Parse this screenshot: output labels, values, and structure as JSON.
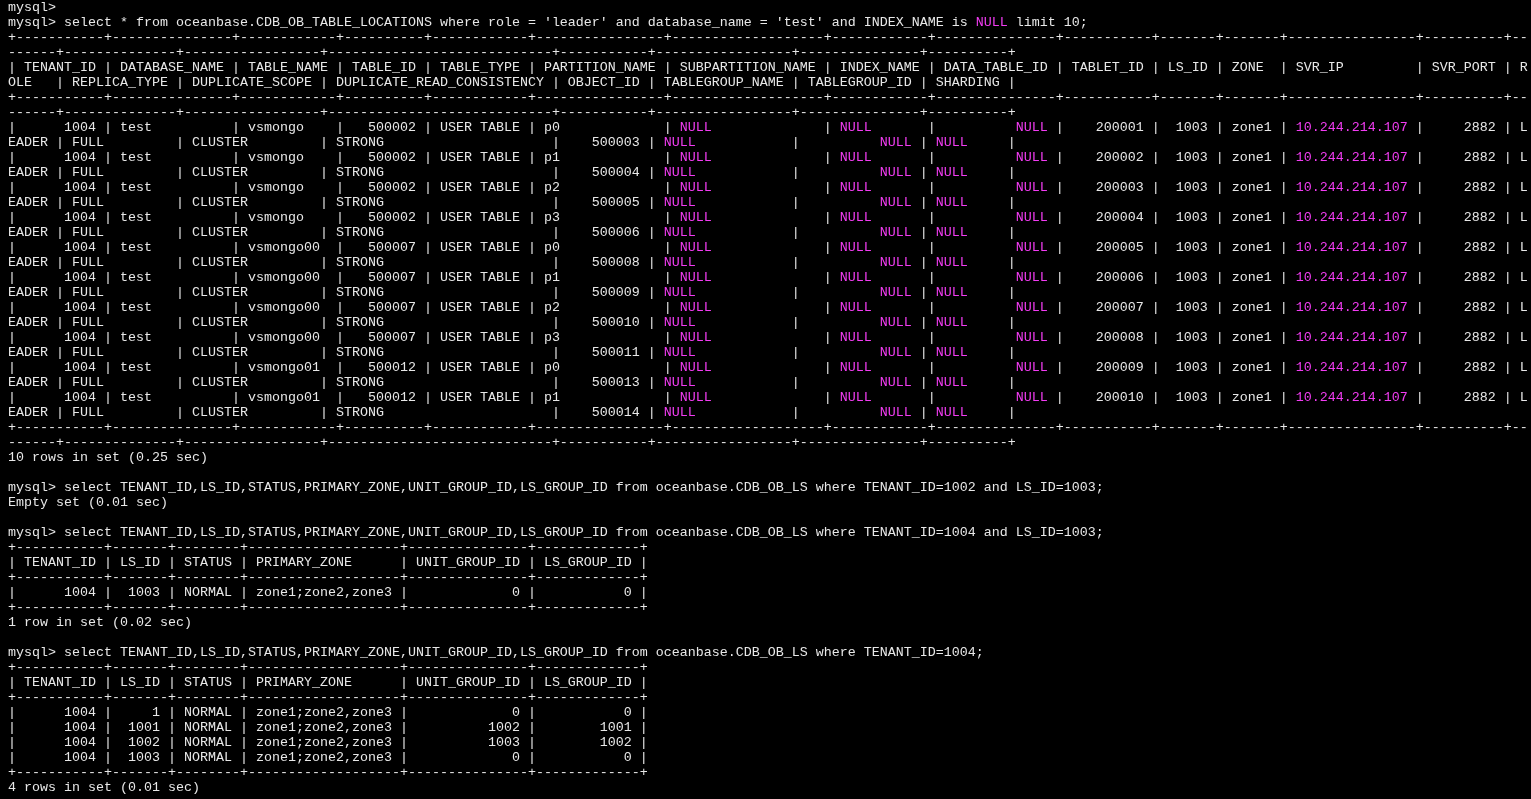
{
  "terminal": {
    "lines": [
      {
        "kind": "text",
        "parts": [
          {
            "text": "mysql>",
            "highlight": false
          }
        ]
      },
      {
        "kind": "text",
        "parts": [
          {
            "text": "mysql> select * from oceanbase.CDB_OB_TABLE_LOCATIONS where role = 'leader' and database_name = 'test' and INDEX_NAME is ",
            "highlight": false
          },
          {
            "text": "NULL",
            "highlight": true
          },
          {
            "text": " limit 10;",
            "highlight": false
          }
        ]
      },
      {
        "kind": "text",
        "parts": [
          {
            "text": "+-----------+---------------+------------+----------+------------+----------------+-------------------+------------+---------------+-----------+-------+-------+----------------+----------+--",
            "highlight": false
          }
        ]
      },
      {
        "kind": "text",
        "parts": [
          {
            "text": "------+--------------+-----------------+----------------------------+-----------+-----------------+---------------+----------+",
            "highlight": false
          }
        ]
      },
      {
        "kind": "text",
        "parts": [
          {
            "text": "| TENANT_ID | DATABASE_NAME | TABLE_NAME | TABLE_ID | TABLE_TYPE | PARTITION_NAME | SUBPARTITION_NAME | INDEX_NAME | DATA_TABLE_ID | TABLET_ID | LS_ID | ZONE  | SVR_IP         | SVR_PORT | R",
            "highlight": false
          }
        ]
      },
      {
        "kind": "text",
        "parts": [
          {
            "text": "OLE   | REPLICA_TYPE | DUPLICATE_SCOPE | DUPLICATE_READ_CONSISTENCY | OBJECT_ID | TABLEGROUP_NAME | TABLEGROUP_ID | SHARDING |",
            "highlight": false
          }
        ]
      },
      {
        "kind": "text",
        "parts": [
          {
            "text": "+-----------+---------------+------------+----------+------------+----------------+-------------------+------------+---------------+-----------+-------+-------+----------------+----------+--",
            "highlight": false
          }
        ]
      },
      {
        "kind": "text",
        "parts": [
          {
            "text": "------+--------------+-----------------+----------------------------+-----------+-----------------+---------------+----------+",
            "highlight": false
          }
        ]
      },
      {
        "kind": "text",
        "parts": [
          {
            "text": "|      1004 | test          | vsmongo    |   500002 | USER TABLE | p0             | ",
            "highlight": false
          },
          {
            "text": "NULL",
            "highlight": true
          },
          {
            "text": "              | ",
            "highlight": false
          },
          {
            "text": "NULL",
            "highlight": true
          },
          {
            "text": "       |          ",
            "highlight": false
          },
          {
            "text": "NULL",
            "highlight": true
          },
          {
            "text": " |    200001 |  1003 | zone1 | ",
            "highlight": false
          },
          {
            "text": "10.244.214.107",
            "highlight": true
          },
          {
            "text": " |     2882 | L",
            "highlight": false
          }
        ]
      },
      {
        "kind": "text",
        "parts": [
          {
            "text": "EADER | FULL         | CLUSTER         | STRONG                     |    500003 | ",
            "highlight": false
          },
          {
            "text": "NULL",
            "highlight": true
          },
          {
            "text": "            |          ",
            "highlight": false
          },
          {
            "text": "NULL",
            "highlight": true
          },
          {
            "text": " | ",
            "highlight": false
          },
          {
            "text": "NULL",
            "highlight": true
          },
          {
            "text": "     |",
            "highlight": false
          }
        ]
      },
      {
        "kind": "text",
        "parts": [
          {
            "text": "|      1004 | test          | vsmongo    |   500002 | USER TABLE | p1             | ",
            "highlight": false
          },
          {
            "text": "NULL",
            "highlight": true
          },
          {
            "text": "              | ",
            "highlight": false
          },
          {
            "text": "NULL",
            "highlight": true
          },
          {
            "text": "       |          ",
            "highlight": false
          },
          {
            "text": "NULL",
            "highlight": true
          },
          {
            "text": " |    200002 |  1003 | zone1 | ",
            "highlight": false
          },
          {
            "text": "10.244.214.107",
            "highlight": true
          },
          {
            "text": " |     2882 | L",
            "highlight": false
          }
        ]
      },
      {
        "kind": "text",
        "parts": [
          {
            "text": "EADER | FULL         | CLUSTER         | STRONG                     |    500004 | ",
            "highlight": false
          },
          {
            "text": "NULL",
            "highlight": true
          },
          {
            "text": "            |          ",
            "highlight": false
          },
          {
            "text": "NULL",
            "highlight": true
          },
          {
            "text": " | ",
            "highlight": false
          },
          {
            "text": "NULL",
            "highlight": true
          },
          {
            "text": "     |",
            "highlight": false
          }
        ]
      },
      {
        "kind": "text",
        "parts": [
          {
            "text": "|      1004 | test          | vsmongo    |   500002 | USER TABLE | p2             | ",
            "highlight": false
          },
          {
            "text": "NULL",
            "highlight": true
          },
          {
            "text": "              | ",
            "highlight": false
          },
          {
            "text": "NULL",
            "highlight": true
          },
          {
            "text": "       |          ",
            "highlight": false
          },
          {
            "text": "NULL",
            "highlight": true
          },
          {
            "text": " |    200003 |  1003 | zone1 | ",
            "highlight": false
          },
          {
            "text": "10.244.214.107",
            "highlight": true
          },
          {
            "text": " |     2882 | L",
            "highlight": false
          }
        ]
      },
      {
        "kind": "text",
        "parts": [
          {
            "text": "EADER | FULL         | CLUSTER         | STRONG                     |    500005 | ",
            "highlight": false
          },
          {
            "text": "NULL",
            "highlight": true
          },
          {
            "text": "            |          ",
            "highlight": false
          },
          {
            "text": "NULL",
            "highlight": true
          },
          {
            "text": " | ",
            "highlight": false
          },
          {
            "text": "NULL",
            "highlight": true
          },
          {
            "text": "     |",
            "highlight": false
          }
        ]
      },
      {
        "kind": "text",
        "parts": [
          {
            "text": "|      1004 | test          | vsmongo    |   500002 | USER TABLE | p3             | ",
            "highlight": false
          },
          {
            "text": "NULL",
            "highlight": true
          },
          {
            "text": "              | ",
            "highlight": false
          },
          {
            "text": "NULL",
            "highlight": true
          },
          {
            "text": "       |          ",
            "highlight": false
          },
          {
            "text": "NULL",
            "highlight": true
          },
          {
            "text": " |    200004 |  1003 | zone1 | ",
            "highlight": false
          },
          {
            "text": "10.244.214.107",
            "highlight": true
          },
          {
            "text": " |     2882 | L",
            "highlight": false
          }
        ]
      },
      {
        "kind": "text",
        "parts": [
          {
            "text": "EADER | FULL         | CLUSTER         | STRONG                     |    500006 | ",
            "highlight": false
          },
          {
            "text": "NULL",
            "highlight": true
          },
          {
            "text": "            |          ",
            "highlight": false
          },
          {
            "text": "NULL",
            "highlight": true
          },
          {
            "text": " | ",
            "highlight": false
          },
          {
            "text": "NULL",
            "highlight": true
          },
          {
            "text": "     |",
            "highlight": false
          }
        ]
      },
      {
        "kind": "text",
        "parts": [
          {
            "text": "|      1004 | test          | vsmongo00  |   500007 | USER TABLE | p0             | ",
            "highlight": false
          },
          {
            "text": "NULL",
            "highlight": true
          },
          {
            "text": "              | ",
            "highlight": false
          },
          {
            "text": "NULL",
            "highlight": true
          },
          {
            "text": "       |          ",
            "highlight": false
          },
          {
            "text": "NULL",
            "highlight": true
          },
          {
            "text": " |    200005 |  1003 | zone1 | ",
            "highlight": false
          },
          {
            "text": "10.244.214.107",
            "highlight": true
          },
          {
            "text": " |     2882 | L",
            "highlight": false
          }
        ]
      },
      {
        "kind": "text",
        "parts": [
          {
            "text": "EADER | FULL         | CLUSTER         | STRONG                     |    500008 | ",
            "highlight": false
          },
          {
            "text": "NULL",
            "highlight": true
          },
          {
            "text": "            |          ",
            "highlight": false
          },
          {
            "text": "NULL",
            "highlight": true
          },
          {
            "text": " | ",
            "highlight": false
          },
          {
            "text": "NULL",
            "highlight": true
          },
          {
            "text": "     |",
            "highlight": false
          }
        ]
      },
      {
        "kind": "text",
        "parts": [
          {
            "text": "|      1004 | test          | vsmongo00  |   500007 | USER TABLE | p1             | ",
            "highlight": false
          },
          {
            "text": "NULL",
            "highlight": true
          },
          {
            "text": "              | ",
            "highlight": false
          },
          {
            "text": "NULL",
            "highlight": true
          },
          {
            "text": "       |          ",
            "highlight": false
          },
          {
            "text": "NULL",
            "highlight": true
          },
          {
            "text": " |    200006 |  1003 | zone1 | ",
            "highlight": false
          },
          {
            "text": "10.244.214.107",
            "highlight": true
          },
          {
            "text": " |     2882 | L",
            "highlight": false
          }
        ]
      },
      {
        "kind": "text",
        "parts": [
          {
            "text": "EADER | FULL         | CLUSTER         | STRONG                     |    500009 | ",
            "highlight": false
          },
          {
            "text": "NULL",
            "highlight": true
          },
          {
            "text": "            |          ",
            "highlight": false
          },
          {
            "text": "NULL",
            "highlight": true
          },
          {
            "text": " | ",
            "highlight": false
          },
          {
            "text": "NULL",
            "highlight": true
          },
          {
            "text": "     |",
            "highlight": false
          }
        ]
      },
      {
        "kind": "text",
        "parts": [
          {
            "text": "|      1004 | test          | vsmongo00  |   500007 | USER TABLE | p2             | ",
            "highlight": false
          },
          {
            "text": "NULL",
            "highlight": true
          },
          {
            "text": "              | ",
            "highlight": false
          },
          {
            "text": "NULL",
            "highlight": true
          },
          {
            "text": "       |          ",
            "highlight": false
          },
          {
            "text": "NULL",
            "highlight": true
          },
          {
            "text": " |    200007 |  1003 | zone1 | ",
            "highlight": false
          },
          {
            "text": "10.244.214.107",
            "highlight": true
          },
          {
            "text": " |     2882 | L",
            "highlight": false
          }
        ]
      },
      {
        "kind": "text",
        "parts": [
          {
            "text": "EADER | FULL         | CLUSTER         | STRONG                     |    500010 | ",
            "highlight": false
          },
          {
            "text": "NULL",
            "highlight": true
          },
          {
            "text": "            |          ",
            "highlight": false
          },
          {
            "text": "NULL",
            "highlight": true
          },
          {
            "text": " | ",
            "highlight": false
          },
          {
            "text": "NULL",
            "highlight": true
          },
          {
            "text": "     |",
            "highlight": false
          }
        ]
      },
      {
        "kind": "text",
        "parts": [
          {
            "text": "|      1004 | test          | vsmongo00  |   500007 | USER TABLE | p3             | ",
            "highlight": false
          },
          {
            "text": "NULL",
            "highlight": true
          },
          {
            "text": "              | ",
            "highlight": false
          },
          {
            "text": "NULL",
            "highlight": true
          },
          {
            "text": "       |          ",
            "highlight": false
          },
          {
            "text": "NULL",
            "highlight": true
          },
          {
            "text": " |    200008 |  1003 | zone1 | ",
            "highlight": false
          },
          {
            "text": "10.244.214.107",
            "highlight": true
          },
          {
            "text": " |     2882 | L",
            "highlight": false
          }
        ]
      },
      {
        "kind": "text",
        "parts": [
          {
            "text": "EADER | FULL         | CLUSTER         | STRONG                     |    500011 | ",
            "highlight": false
          },
          {
            "text": "NULL",
            "highlight": true
          },
          {
            "text": "            |          ",
            "highlight": false
          },
          {
            "text": "NULL",
            "highlight": true
          },
          {
            "text": " | ",
            "highlight": false
          },
          {
            "text": "NULL",
            "highlight": true
          },
          {
            "text": "     |",
            "highlight": false
          }
        ]
      },
      {
        "kind": "text",
        "parts": [
          {
            "text": "|      1004 | test          | vsmongo01  |   500012 | USER TABLE | p0             | ",
            "highlight": false
          },
          {
            "text": "NULL",
            "highlight": true
          },
          {
            "text": "              | ",
            "highlight": false
          },
          {
            "text": "NULL",
            "highlight": true
          },
          {
            "text": "       |          ",
            "highlight": false
          },
          {
            "text": "NULL",
            "highlight": true
          },
          {
            "text": " |    200009 |  1003 | zone1 | ",
            "highlight": false
          },
          {
            "text": "10.244.214.107",
            "highlight": true
          },
          {
            "text": " |     2882 | L",
            "highlight": false
          }
        ]
      },
      {
        "kind": "text",
        "parts": [
          {
            "text": "EADER | FULL         | CLUSTER         | STRONG                     |    500013 | ",
            "highlight": false
          },
          {
            "text": "NULL",
            "highlight": true
          },
          {
            "text": "            |          ",
            "highlight": false
          },
          {
            "text": "NULL",
            "highlight": true
          },
          {
            "text": " | ",
            "highlight": false
          },
          {
            "text": "NULL",
            "highlight": true
          },
          {
            "text": "     |",
            "highlight": false
          }
        ]
      },
      {
        "kind": "text",
        "parts": [
          {
            "text": "|      1004 | test          | vsmongo01  |   500012 | USER TABLE | p1             | ",
            "highlight": false
          },
          {
            "text": "NULL",
            "highlight": true
          },
          {
            "text": "              | ",
            "highlight": false
          },
          {
            "text": "NULL",
            "highlight": true
          },
          {
            "text": "       |          ",
            "highlight": false
          },
          {
            "text": "NULL",
            "highlight": true
          },
          {
            "text": " |    200010 |  1003 | zone1 | ",
            "highlight": false
          },
          {
            "text": "10.244.214.107",
            "highlight": true
          },
          {
            "text": " |     2882 | L",
            "highlight": false
          }
        ]
      },
      {
        "kind": "text",
        "parts": [
          {
            "text": "EADER | FULL         | CLUSTER         | STRONG                     |    500014 | ",
            "highlight": false
          },
          {
            "text": "NULL",
            "highlight": true
          },
          {
            "text": "            |          ",
            "highlight": false
          },
          {
            "text": "NULL",
            "highlight": true
          },
          {
            "text": " | ",
            "highlight": false
          },
          {
            "text": "NULL",
            "highlight": true
          },
          {
            "text": "     |",
            "highlight": false
          }
        ]
      },
      {
        "kind": "text",
        "parts": [
          {
            "text": "+-----------+---------------+------------+----------+------------+----------------+-------------------+------------+---------------+-----------+-------+-------+----------------+----------+--",
            "highlight": false
          }
        ]
      },
      {
        "kind": "text",
        "parts": [
          {
            "text": "------+--------------+-----------------+----------------------------+-----------+-----------------+---------------+----------+",
            "highlight": false
          }
        ]
      },
      {
        "kind": "text",
        "parts": [
          {
            "text": "10 rows in set (0.25 sec)",
            "highlight": false
          }
        ]
      },
      {
        "kind": "blank"
      },
      {
        "kind": "text",
        "parts": [
          {
            "text": "mysql> select TENANT_ID,LS_ID,STATUS,PRIMARY_ZONE,UNIT_GROUP_ID,LS_GROUP_ID from oceanbase.CDB_OB_LS where TENANT_ID=1002 and LS_ID=1003;",
            "highlight": false
          }
        ]
      },
      {
        "kind": "text",
        "parts": [
          {
            "text": "Empty set (0.01 sec)",
            "highlight": false
          }
        ]
      },
      {
        "kind": "blank"
      },
      {
        "kind": "text",
        "parts": [
          {
            "text": "mysql> select TENANT_ID,LS_ID,STATUS,PRIMARY_ZONE,UNIT_GROUP_ID,LS_GROUP_ID from oceanbase.CDB_OB_LS where TENANT_ID=1004 and LS_ID=1003;",
            "highlight": false
          }
        ]
      },
      {
        "kind": "text",
        "parts": [
          {
            "text": "+-----------+-------+--------+-------------------+---------------+-------------+",
            "highlight": false
          }
        ]
      },
      {
        "kind": "text",
        "parts": [
          {
            "text": "| TENANT_ID | LS_ID | STATUS | PRIMARY_ZONE      | UNIT_GROUP_ID | LS_GROUP_ID |",
            "highlight": false
          }
        ]
      },
      {
        "kind": "text",
        "parts": [
          {
            "text": "+-----------+-------+--------+-------------------+---------------+-------------+",
            "highlight": false
          }
        ]
      },
      {
        "kind": "text",
        "parts": [
          {
            "text": "|      1004 |  1003 | NORMAL | zone1;zone2,zone3 |             0 |           0 |",
            "highlight": false
          }
        ]
      },
      {
        "kind": "text",
        "parts": [
          {
            "text": "+-----------+-------+--------+-------------------+---------------+-------------+",
            "highlight": false
          }
        ]
      },
      {
        "kind": "text",
        "parts": [
          {
            "text": "1 row in set (0.02 sec)",
            "highlight": false
          }
        ]
      },
      {
        "kind": "blank"
      },
      {
        "kind": "text",
        "parts": [
          {
            "text": "mysql> select TENANT_ID,LS_ID,STATUS,PRIMARY_ZONE,UNIT_GROUP_ID,LS_GROUP_ID from oceanbase.CDB_OB_LS where TENANT_ID=1004;",
            "highlight": false
          }
        ]
      },
      {
        "kind": "text",
        "parts": [
          {
            "text": "+-----------+-------+--------+-------------------+---------------+-------------+",
            "highlight": false
          }
        ]
      },
      {
        "kind": "text",
        "parts": [
          {
            "text": "| TENANT_ID | LS_ID | STATUS | PRIMARY_ZONE      | UNIT_GROUP_ID | LS_GROUP_ID |",
            "highlight": false
          }
        ]
      },
      {
        "kind": "text",
        "parts": [
          {
            "text": "+-----------+-------+--------+-------------------+---------------+-------------+",
            "highlight": false
          }
        ]
      },
      {
        "kind": "text",
        "parts": [
          {
            "text": "|      1004 |     1 | NORMAL | zone1;zone2,zone3 |             0 |           0 |",
            "highlight": false
          }
        ]
      },
      {
        "kind": "text",
        "parts": [
          {
            "text": "|      1004 |  1001 | NORMAL | zone1;zone2,zone3 |          1002 |        1001 |",
            "highlight": false
          }
        ]
      },
      {
        "kind": "text",
        "parts": [
          {
            "text": "|      1004 |  1002 | NORMAL | zone1;zone2,zone3 |          1003 |        1002 |",
            "highlight": false
          }
        ]
      },
      {
        "kind": "text",
        "parts": [
          {
            "text": "|      1004 |  1003 | NORMAL | zone1;zone2,zone3 |             0 |           0 |",
            "highlight": false
          }
        ]
      },
      {
        "kind": "text",
        "parts": [
          {
            "text": "+-----------+-------+--------+-------------------+---------------+-------------+",
            "highlight": false
          }
        ]
      },
      {
        "kind": "text",
        "parts": [
          {
            "text": "4 rows in set (0.01 sec)",
            "highlight": false
          }
        ]
      }
    ]
  }
}
